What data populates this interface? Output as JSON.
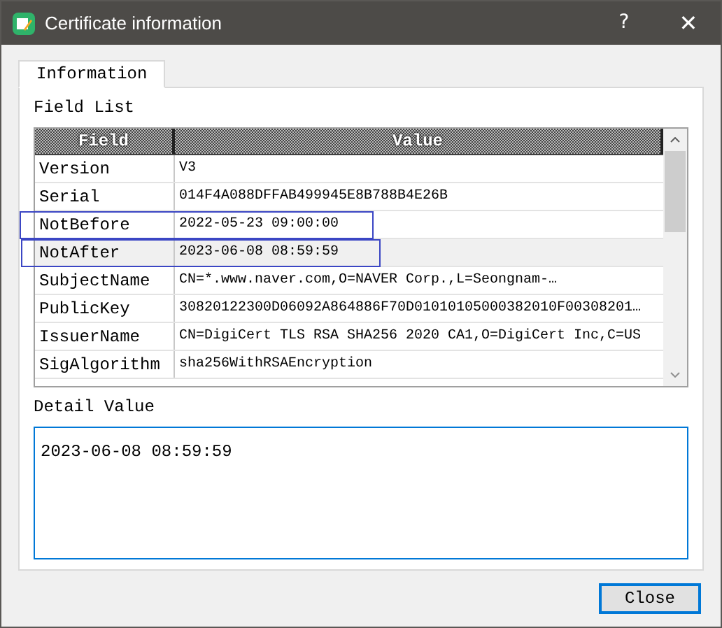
{
  "window": {
    "title": "Certificate information",
    "buttons": [
      "?",
      "✕"
    ]
  },
  "tabs": [
    {
      "label": "Information",
      "selected": true
    }
  ],
  "field_list": {
    "label": "Field List",
    "columns": [
      "Field",
      "Value"
    ],
    "rows": [
      {
        "field": "Version",
        "value": "V3",
        "selected": false,
        "outlined": false
      },
      {
        "field": "Serial",
        "value": "014F4A088DFFAB499945E8B788B4E26B",
        "selected": false,
        "outlined": false
      },
      {
        "field": "NotBefore",
        "value": "2022-05-23 09:00:00",
        "selected": false,
        "outlined": true
      },
      {
        "field": "NotAfter",
        "value": "2023-06-08 08:59:59",
        "selected": true,
        "outlined": true
      },
      {
        "field": "SubjectName",
        "value": "CN=*.www.naver.com,O=NAVER Corp.,L=Seongnam-…",
        "selected": false,
        "outlined": false
      },
      {
        "field": "PublicKey",
        "value": "30820122300D06092A864886F70D01010105000382010F00308201…",
        "selected": false,
        "outlined": false
      },
      {
        "field": "IssuerName",
        "value": "CN=DigiCert TLS RSA SHA256 2020 CA1,O=DigiCert Inc,C=US",
        "selected": false,
        "outlined": false
      },
      {
        "field": "SigAlgorithm",
        "value": "sha256WithRSAEncryption",
        "selected": false,
        "outlined": false
      }
    ]
  },
  "detail": {
    "label": "Detail Value",
    "value": "2023-06-08 08:59:59"
  },
  "buttons": [
    {
      "label": "Close"
    }
  ]
}
